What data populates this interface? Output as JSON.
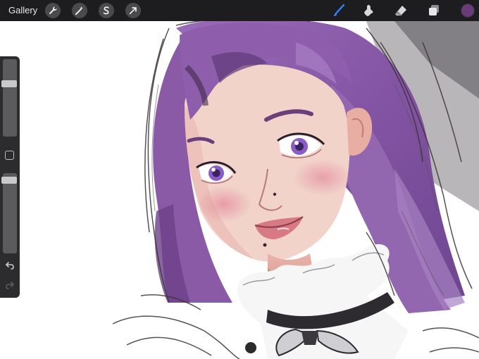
{
  "toolbar": {
    "gallery_label": "Gallery",
    "left_tools": [
      "wrench-icon",
      "magic-wand-icon",
      "selection-s-icon",
      "arrow-cursor-icon"
    ],
    "right_tools": [
      "brush-icon",
      "smudge-icon",
      "eraser-icon",
      "layers-icon"
    ],
    "active_tool": "brush-icon",
    "active_tool_color": "#2f86ff",
    "current_color": "#6b3a78"
  },
  "sidebar": {
    "brush_size_level": 0.7,
    "opacity_level": 0.95,
    "modify_icon": "square-outline-icon",
    "undo_icon": "undo-arrow-icon",
    "redo_icon": "redo-arrow-icon"
  },
  "colors": {
    "toolbar_bg": "#1d1d1f",
    "sidebar_bg": "#2c2c2e",
    "hair_purple": "#8a5aa6",
    "skin": "#f0cfc6",
    "blush": "#e7a3ae"
  }
}
